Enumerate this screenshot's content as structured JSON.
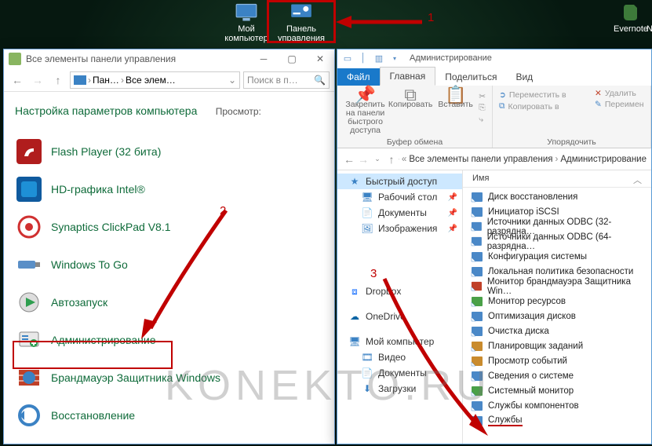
{
  "desktop": {
    "my_computer": "Мой\nкомпьютер",
    "control_panel": "Панель\nуправления",
    "evernote": "Evernote",
    "right_cut": "No"
  },
  "annotations": {
    "n1": "1",
    "n2": "2",
    "n3": "3"
  },
  "left_window": {
    "title": "Все элементы панели управления",
    "address_part1": "Пан…",
    "address_part2": "Все элем…",
    "search_placeholder": "Поиск в п…",
    "heading": "Настройка параметров компьютера",
    "view_label": "Просмотр:",
    "items": [
      {
        "label": "Flash Player (32 бита)"
      },
      {
        "label": "HD-графика Intel®"
      },
      {
        "label": "Synaptics ClickPad V8.1"
      },
      {
        "label": "Windows To Go"
      },
      {
        "label": "Автозапуск"
      },
      {
        "label": "Администрирование"
      },
      {
        "label": "Брандмауэр Защитника Windows"
      },
      {
        "label": "Восстановление"
      }
    ]
  },
  "right_window": {
    "title_tail": "Администрирование",
    "tabs": {
      "file": "Файл",
      "home": "Главная",
      "share": "Поделиться",
      "view": "Вид"
    },
    "ribbon": {
      "pin": "Закрепить на панели быстрого доступа",
      "copy": "Копировать",
      "paste": "Вставить",
      "clipboard_group": "Буфер обмена",
      "move_to": "Переместить в",
      "copy_to": "Копировать в",
      "delete": "Удалить",
      "rename": "Переимен",
      "organize_group": "Упорядочить"
    },
    "address": {
      "p1": "Все элементы панели управления",
      "p2": "Администрирование"
    },
    "nav": {
      "quick": "Быстрый доступ",
      "desktop": "Рабочий стол",
      "documents": "Документы",
      "pictures": "Изображения",
      "dropbox": "Dropbox",
      "onedrive": "OneDrive",
      "mypc": "Мой компьютер",
      "video": "Видео",
      "docs2": "Документы",
      "downloads": "Загрузки"
    },
    "column_header": "Имя",
    "files": [
      "Диск восстановления",
      "Инициатор iSCSI",
      "Источники данных ODBC (32-разрядна…",
      "Источники данных ODBC (64-разрядна…",
      "Конфигурация системы",
      "Локальная политика безопасности",
      "Монитор брандмауэра Защитника Win…",
      "Монитор ресурсов",
      "Оптимизация дисков",
      "Очистка диска",
      "Планировщик заданий",
      "Просмотр событий",
      "Сведения о системе",
      "Системный монитор",
      "Службы компонентов",
      "Службы"
    ]
  },
  "watermark": "KONEKTO.RU"
}
